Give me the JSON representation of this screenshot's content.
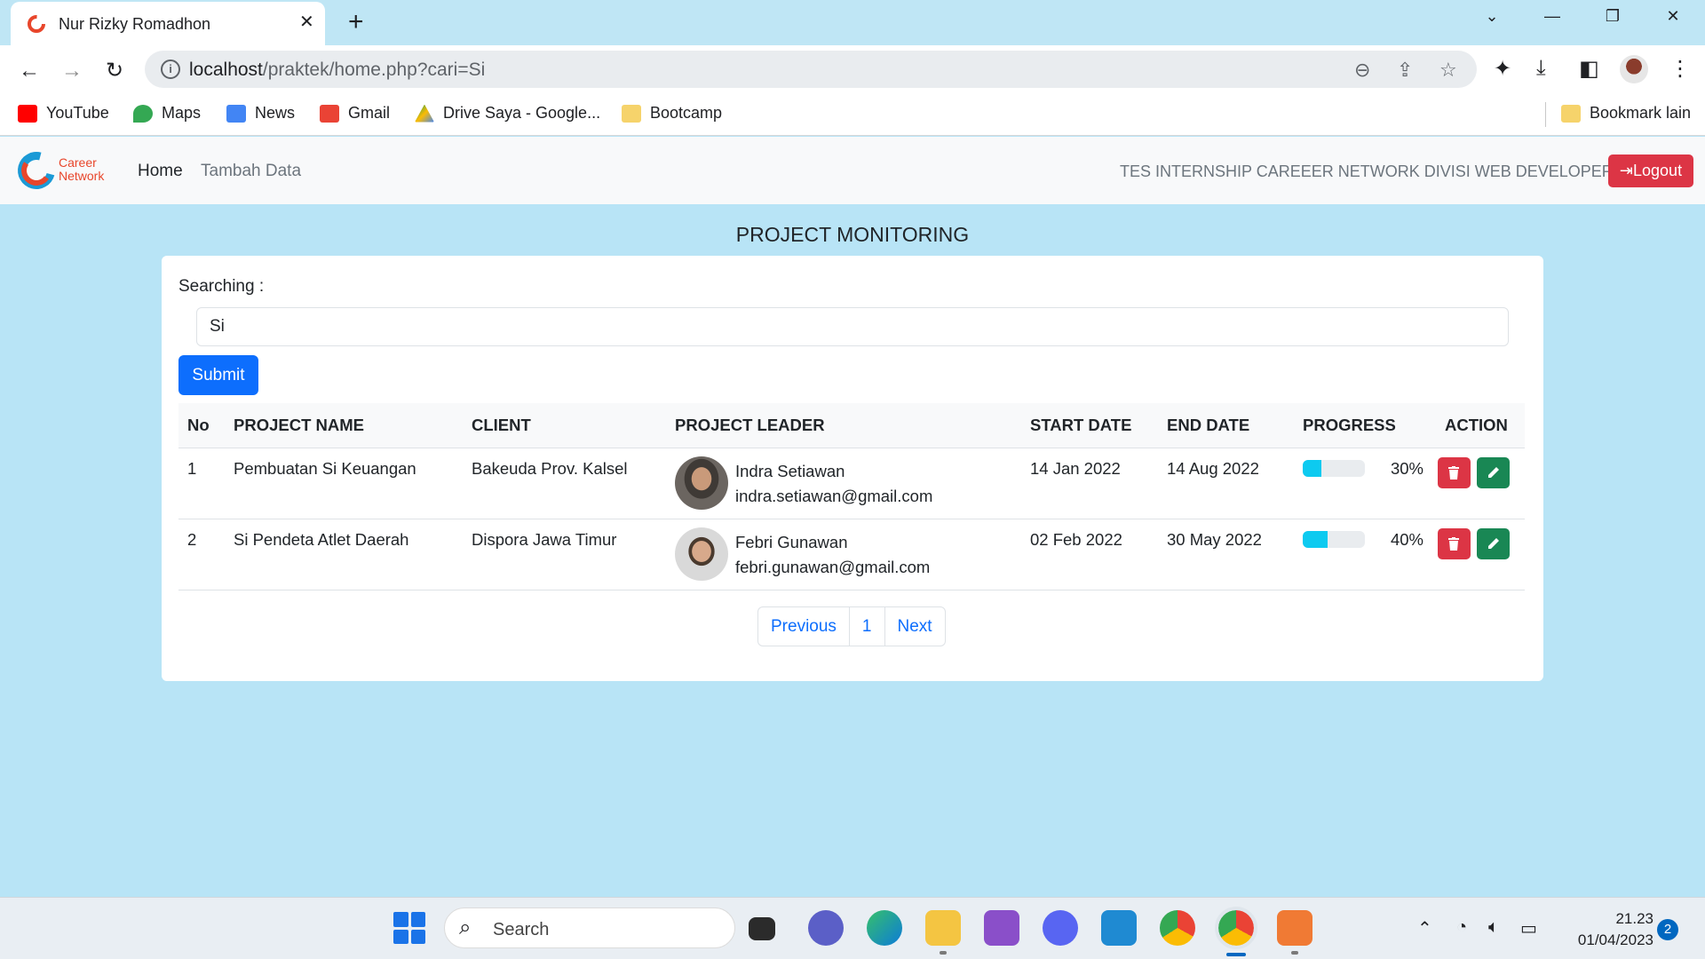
{
  "browser": {
    "tab_title": "Nur Rizky Romadhon",
    "url_host": "localhost",
    "url_path": "/praktek/home.php?cari=Si",
    "bookmarks": [
      {
        "label": "YouTube",
        "color": "#ff0000"
      },
      {
        "label": "Maps",
        "color": "#34a853"
      },
      {
        "label": "News",
        "color": "#4285f4"
      },
      {
        "label": "Gmail",
        "color": "#ea4335"
      },
      {
        "label": "Drive Saya - Google...",
        "color": "#fbbc04"
      },
      {
        "label": "Bootcamp",
        "color": "#f6d36b"
      }
    ],
    "other_bookmarks": "Bookmark lain"
  },
  "navbar": {
    "brand_line1": "Career",
    "brand_line2": "Network",
    "links": [
      "Home",
      "Tambah Data"
    ],
    "info": "TES INTERNSHIP CAREEER NETWORK DIVISI WEB DEVELOPER",
    "logout": "Logout"
  },
  "main": {
    "title": "PROJECT MONITORING",
    "search_label": "Searching :",
    "search_value": "Si",
    "submit": "Submit",
    "columns": [
      "No",
      "PROJECT NAME",
      "CLIENT",
      "PROJECT LEADER",
      "START DATE",
      "END DATE",
      "PROGRESS",
      "ACTION"
    ],
    "rows": [
      {
        "no": "1",
        "project": "Pembuatan Si Keuangan",
        "client": "Bakeuda Prov. Kalsel",
        "leader": "Indra Setiawan",
        "email": "indra.setiawan@gmail.com",
        "start": "14 Jan 2022",
        "end": "14 Aug 2022",
        "progress_label": "30%",
        "progress": 0.3
      },
      {
        "no": "2",
        "project": "Si Pendeta Atlet Daerah",
        "client": "Dispora Jawa Timur",
        "leader": "Febri Gunawan",
        "email": "febri.gunawan@gmail.com",
        "start": "02 Feb 2022",
        "end": "30 May 2022",
        "progress_label": "40%",
        "progress": 0.4
      }
    ],
    "pagination": [
      "Previous",
      "1",
      "Next"
    ]
  },
  "taskbar": {
    "search": "Search",
    "time": "21.23",
    "date": "01/04/2023",
    "notifications": "2"
  },
  "colors": {
    "page_bg": "#b8e4f6",
    "primary": "#0d6efd",
    "danger": "#dc3545",
    "success": "#198754",
    "info": "#0dcaf0"
  }
}
